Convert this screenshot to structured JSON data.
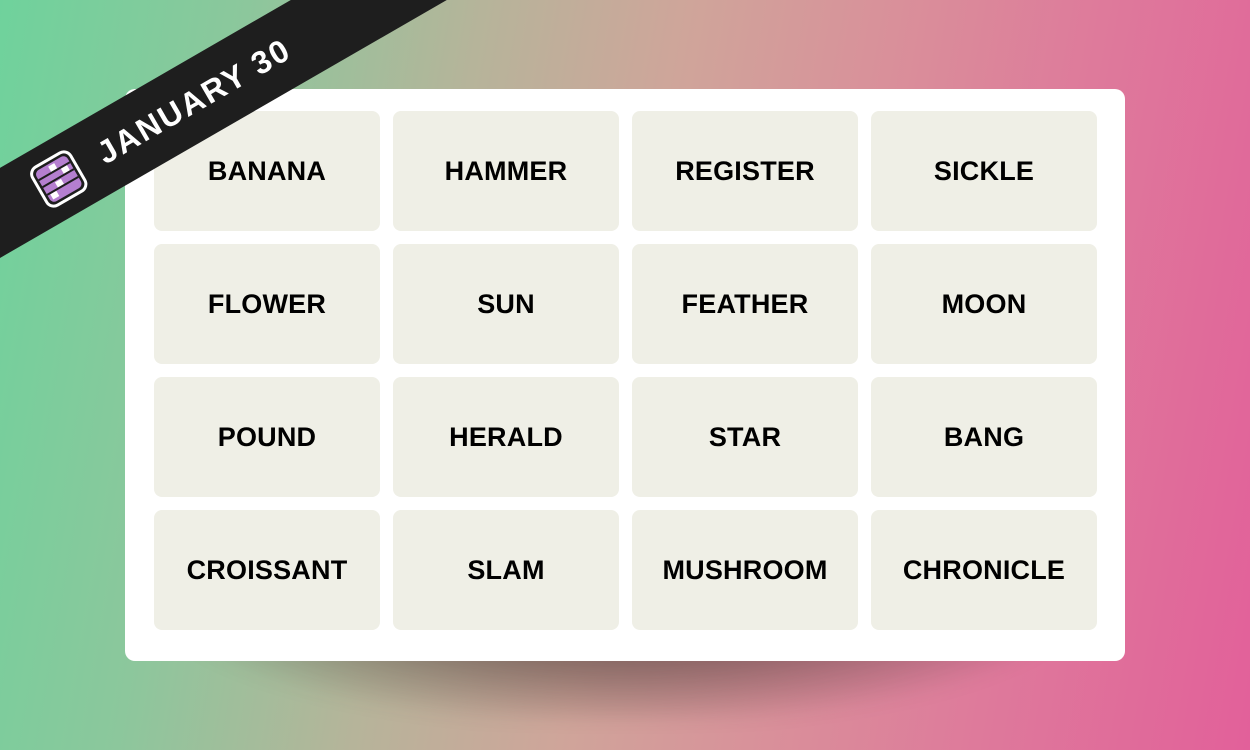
{
  "banner": {
    "date_label": "JANUARY 30",
    "logo_icon": "connections-grid-icon",
    "colors": {
      "ribbon": "#1e1e1e",
      "logo_purple": "#b57fd0"
    }
  },
  "board": {
    "tiles": [
      [
        "BANANA",
        "HAMMER",
        "REGISTER",
        "SICKLE"
      ],
      [
        "FLOWER",
        "SUN",
        "FEATHER",
        "MOON"
      ],
      [
        "POUND",
        "HERALD",
        "STAR",
        "BANG"
      ],
      [
        "CROISSANT",
        "SLAM",
        "MUSHROOM",
        "CHRONICLE"
      ]
    ],
    "colors": {
      "tile_bg": "#efefe6",
      "card_bg": "#ffffff"
    }
  }
}
